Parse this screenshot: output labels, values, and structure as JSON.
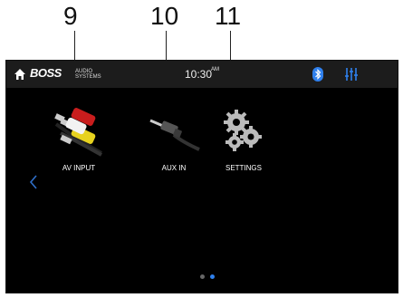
{
  "callouts": [
    "9",
    "10",
    "11"
  ],
  "statusbar": {
    "brand_name": "BOSS",
    "brand_sub": "AUDIO\nSYSTEMS",
    "time": "10:30",
    "ampm": "AM",
    "icons": [
      "home-icon",
      "bluetooth-icon",
      "equalizer-icon"
    ],
    "bluetooth_color": "#2f80ed",
    "eq_color": "#2f80ed"
  },
  "apps": [
    {
      "label": "AV INPUT",
      "icon": "rca-cable-icon"
    },
    {
      "label": "AUX IN",
      "icon": "aux-cable-icon"
    },
    {
      "label": "SETTINGS",
      "icon": "gears-icon"
    }
  ],
  "nav": {
    "left_icon": "chevron-left-icon",
    "accent": "#2f6fc9"
  },
  "pager": {
    "pages": 2,
    "active": 2,
    "active_color": "#2f80ed",
    "inactive_color": "#666666"
  }
}
